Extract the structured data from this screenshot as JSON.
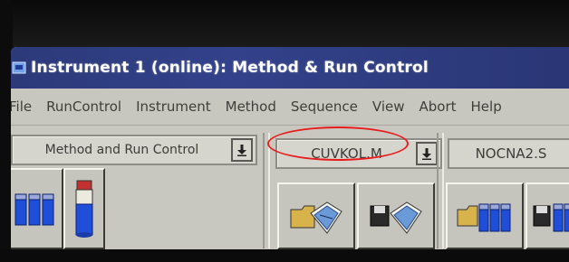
{
  "window": {
    "title": "Instrument 1 (online): Method & Run Control"
  },
  "menu": {
    "items": [
      {
        "label": "File"
      },
      {
        "label": "RunControl"
      },
      {
        "label": "Instrument"
      },
      {
        "label": "Method"
      },
      {
        "label": "Sequence"
      },
      {
        "label": "View"
      },
      {
        "label": "Abort"
      },
      {
        "label": "Help"
      }
    ]
  },
  "toolbar": {
    "view_selector": {
      "value": "Method and Run Control"
    },
    "method_selector": {
      "value": "CUVKOL.M",
      "highlight_color": "#e81c1c"
    },
    "sequence_field": {
      "value": "NOCNA2.S"
    }
  },
  "icons": {
    "window": "instrument-icon",
    "vials": "vial-tray-icon",
    "single_vial": "single-vial-icon",
    "load_method": "load-method-icon",
    "save_method": "save-method-icon",
    "load_sequence": "load-sequence-icon",
    "save_sequence": "save-sequence-icon"
  },
  "colors": {
    "titlebar": "#2c3a7a",
    "window_bg": "#c9c8c0",
    "vial_blue": "#1f4fd8"
  }
}
